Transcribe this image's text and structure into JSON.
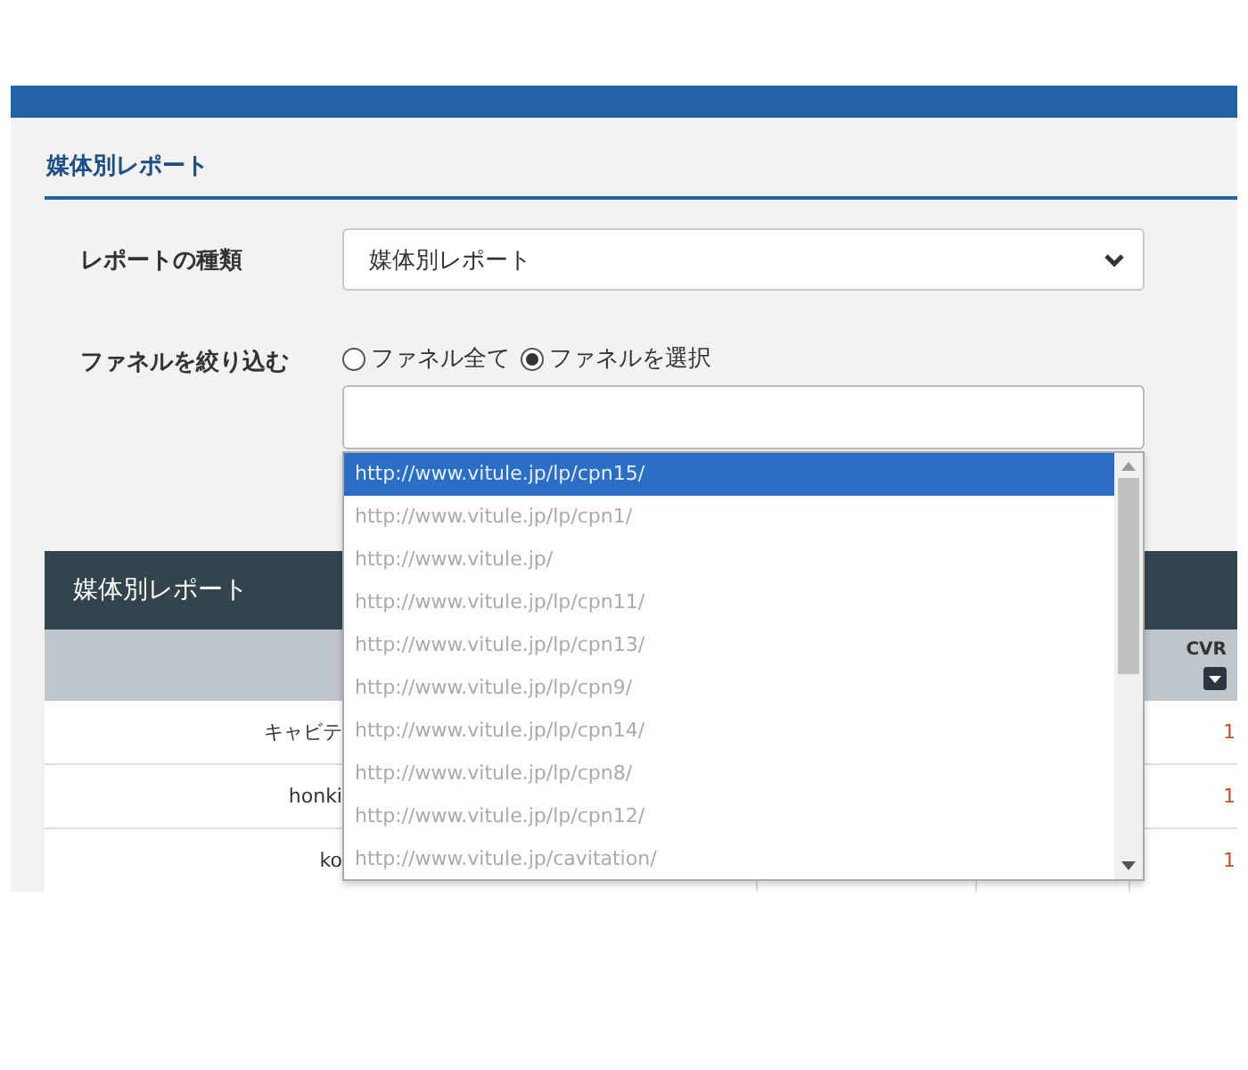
{
  "section_title": "媒体別レポート",
  "report_type": {
    "label": "レポートの種類",
    "value": "媒体別レポート"
  },
  "funnel": {
    "label": "ファネルを絞り込む",
    "options": [
      {
        "label": "ファネル全て",
        "selected": false
      },
      {
        "label": "ファネルを選択",
        "selected": true
      }
    ]
  },
  "dropdown": {
    "items": [
      {
        "label": "http://www.vitule.jp/lp/cpn15/",
        "selected": true
      },
      {
        "label": "http://www.vitule.jp/lp/cpn1/",
        "selected": false
      },
      {
        "label": "http://www.vitule.jp/",
        "selected": false
      },
      {
        "label": "http://www.vitule.jp/lp/cpn11/",
        "selected": false
      },
      {
        "label": "http://www.vitule.jp/lp/cpn13/",
        "selected": false
      },
      {
        "label": "http://www.vitule.jp/lp/cpn9/",
        "selected": false
      },
      {
        "label": "http://www.vitule.jp/lp/cpn14/",
        "selected": false
      },
      {
        "label": "http://www.vitule.jp/lp/cpn8/",
        "selected": false
      },
      {
        "label": "http://www.vitule.jp/lp/cpn12/",
        "selected": false
      },
      {
        "label": "http://www.vitule.jp/cavitation/",
        "selected": false
      }
    ]
  },
  "table": {
    "title": "媒体別レポート",
    "cvr_header": "CVR",
    "rows": [
      {
        "name": "キャビテ",
        "cvr": "1"
      },
      {
        "name": "honki",
        "cvr": "1"
      },
      {
        "name": "ko",
        "cvr": "1"
      }
    ]
  }
}
